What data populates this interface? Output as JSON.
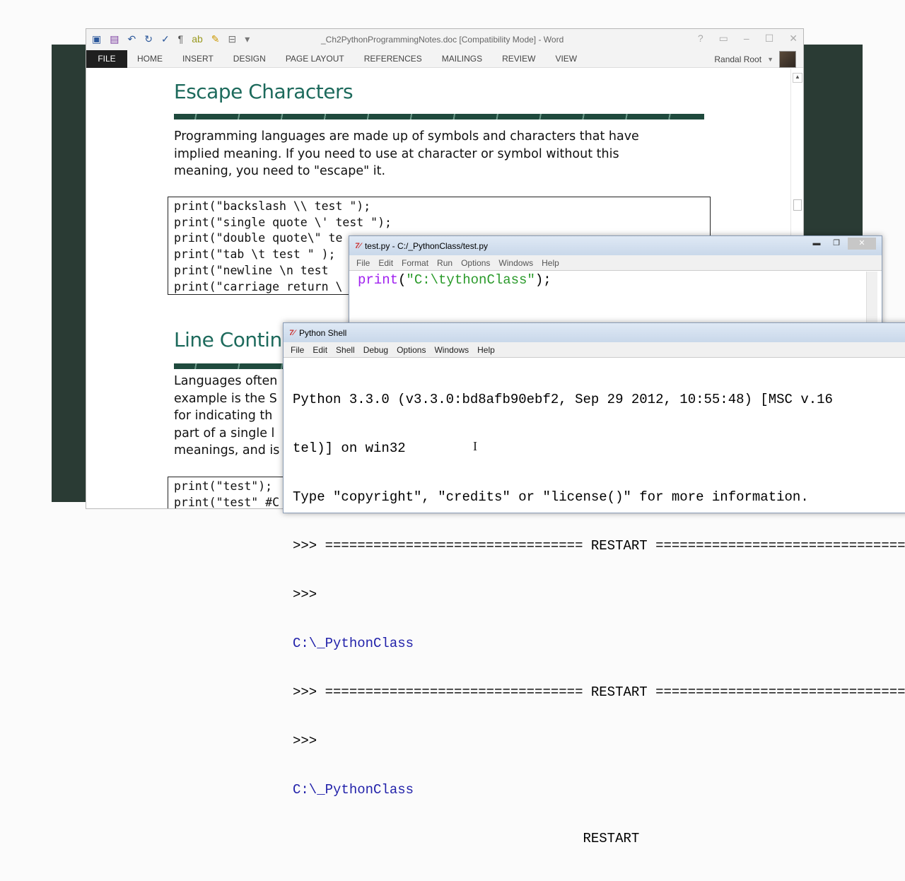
{
  "word": {
    "title": "_Ch2PythonProgrammingNotes.doc [Compatibility Mode] - Word",
    "tabs": [
      "FILE",
      "HOME",
      "INSERT",
      "DESIGN",
      "PAGE LAYOUT",
      "REFERENCES",
      "MAILINGS",
      "REVIEW",
      "VIEW"
    ],
    "user": "Randal Root",
    "heading1": "Escape Characters",
    "para1": [
      "Programming languages are made up of symbols and characters that have",
      "implied meaning. If you need to use at character or symbol without this",
      "meaning, you need to \"escape\" it."
    ],
    "code1": [
      "print(\"backslash \\\\ test \");",
      "print(\"single quote \\' test \");",
      "print(\"double quote\\\" te",
      "print(\"tab \\t test \" );",
      "print(\"newline \\n test ",
      "print(\"carriage return \\"
    ],
    "heading2": "Line Contin",
    "para2": [
      "Languages often",
      "example is the S",
      "for indicating th",
      "part of a single l",
      "meanings, and is"
    ],
    "code2": [
      "print(\"test\");",
      "print(\"test\" #C"
    ]
  },
  "editor": {
    "title": "test.py - C:/_PythonClass/test.py",
    "menu": [
      "File",
      "Edit",
      "Format",
      "Run",
      "Options",
      "Windows",
      "Help"
    ],
    "code_kw": "print",
    "code_open": "(",
    "code_str": "\"C:\\tythonClass\"",
    "code_close": ");"
  },
  "shell": {
    "title": "Python Shell",
    "menu": [
      "File",
      "Edit",
      "Shell",
      "Debug",
      "Options",
      "Windows",
      "Help"
    ],
    "lines": [
      "Python 3.3.0 (v3.3.0:bd8afb90ebf2, Sep 29 2012, 10:55:48) [MSC v.16",
      "tel)] on win32",
      "Type \"copyright\", \"credits\" or \"license()\" for more information.",
      ">>> ================================ RESTART ================================",
      ">>> "
    ],
    "output1": "C:\\_PythonClass",
    "restart2": ">>> ================================ RESTART ================================",
    "prompt2": ">>> ",
    "output2": "C:\\_PythonClass",
    "restart3": "                                    RESTART"
  }
}
